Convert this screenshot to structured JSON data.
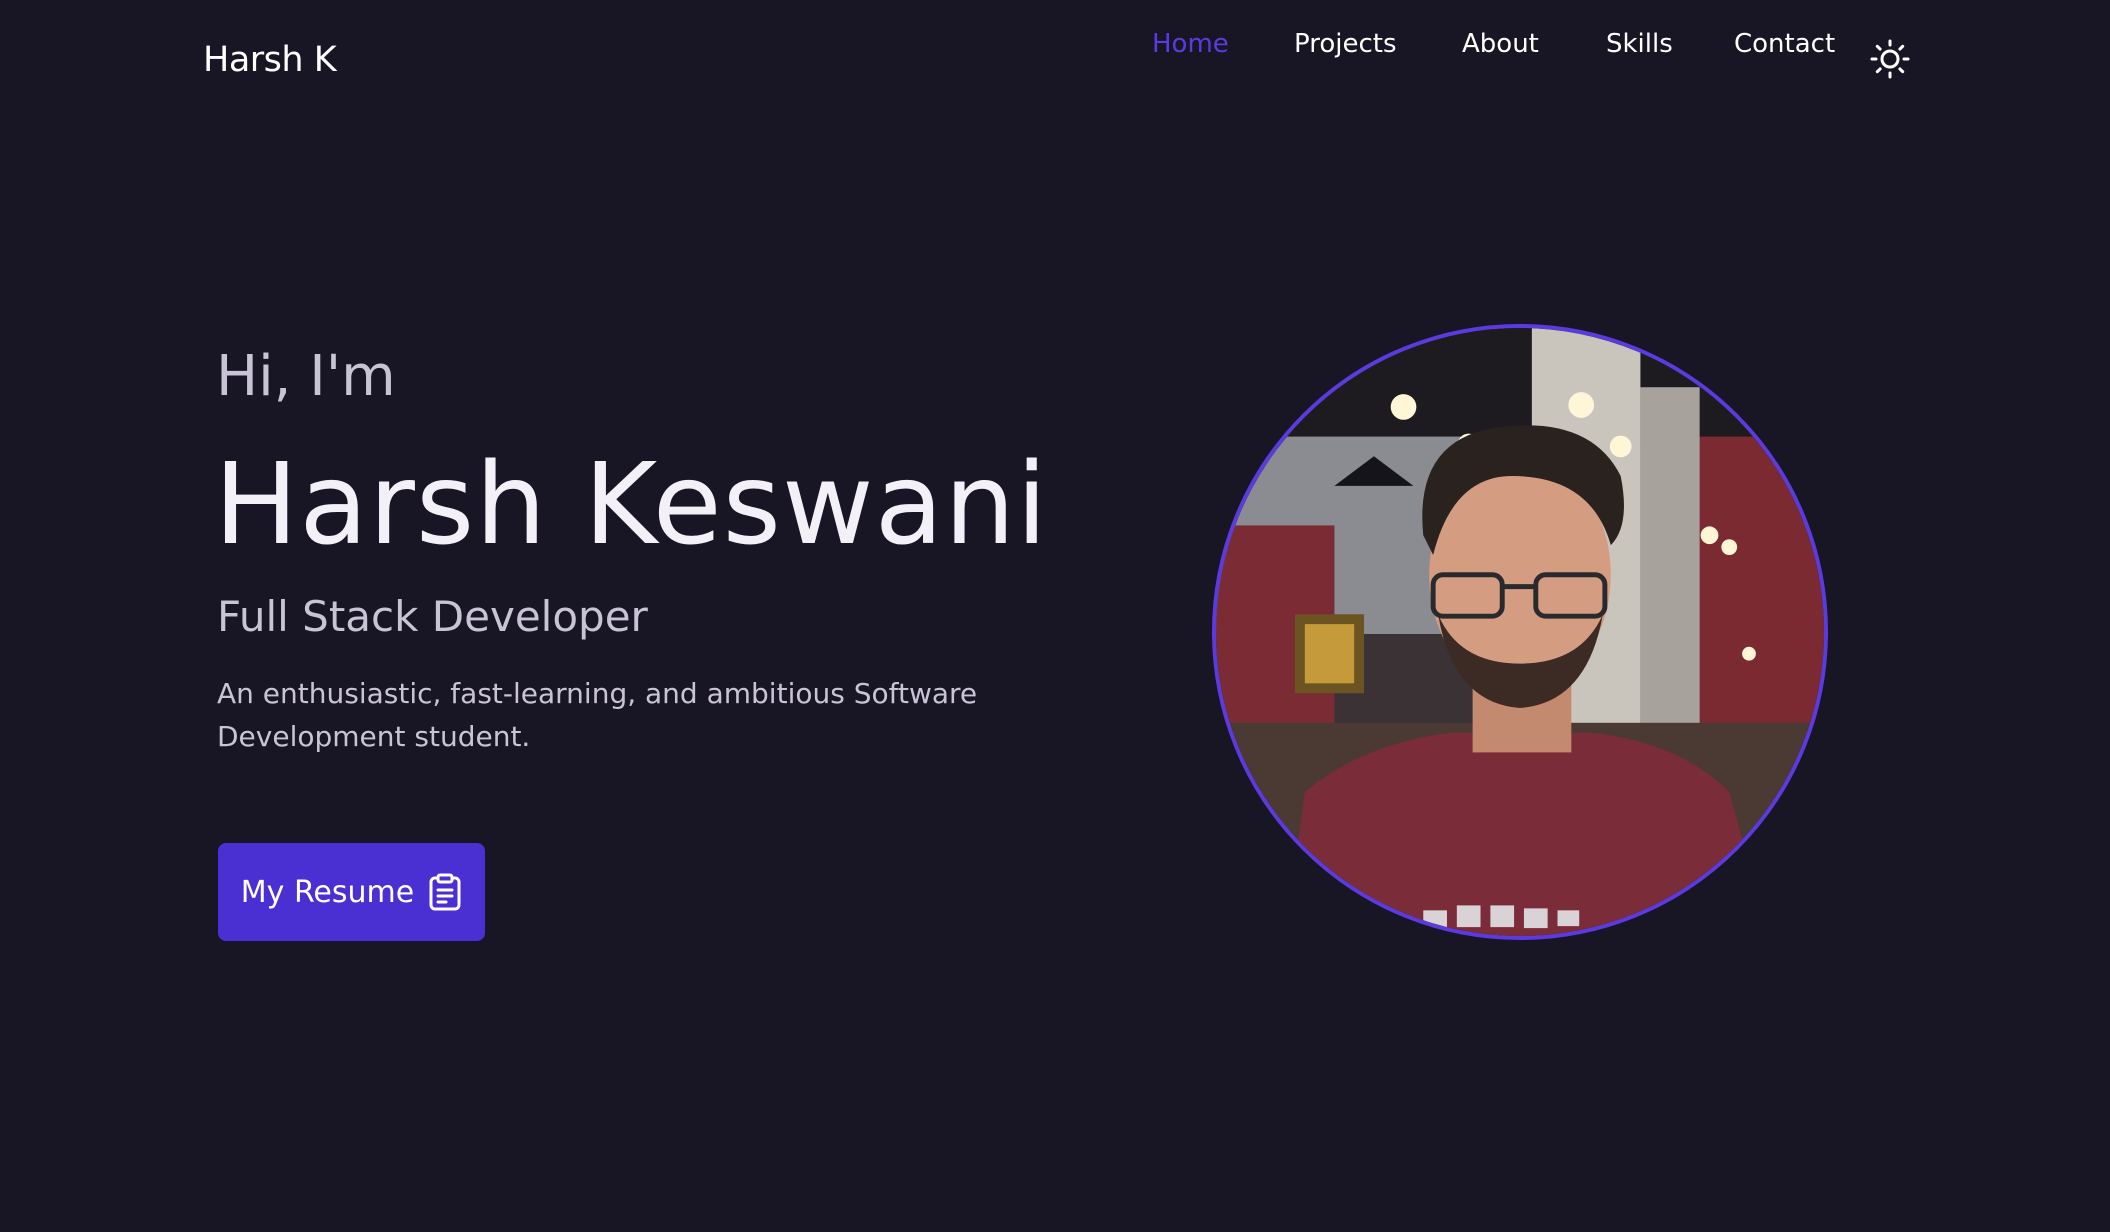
{
  "header": {
    "logo": "Harsh K",
    "nav": [
      {
        "label": "Home",
        "active": true
      },
      {
        "label": "Projects",
        "active": false
      },
      {
        "label": "About",
        "active": false
      },
      {
        "label": "Skills",
        "active": false
      },
      {
        "label": "Contact",
        "active": false
      }
    ],
    "theme_icon": "sun-icon"
  },
  "hero": {
    "greeting": "Hi, I'm",
    "name": "Harsh Keswani",
    "role": "Full Stack Developer",
    "description": "An enthusiastic, fast-learning, and ambitious Software Development student.",
    "resume_label": "My Resume",
    "resume_icon": "clipboard-icon"
  },
  "colors": {
    "background": "#181624",
    "accent": "#5b3be0",
    "button": "#4a2fd3",
    "muted_text": "#c9c3d6"
  }
}
